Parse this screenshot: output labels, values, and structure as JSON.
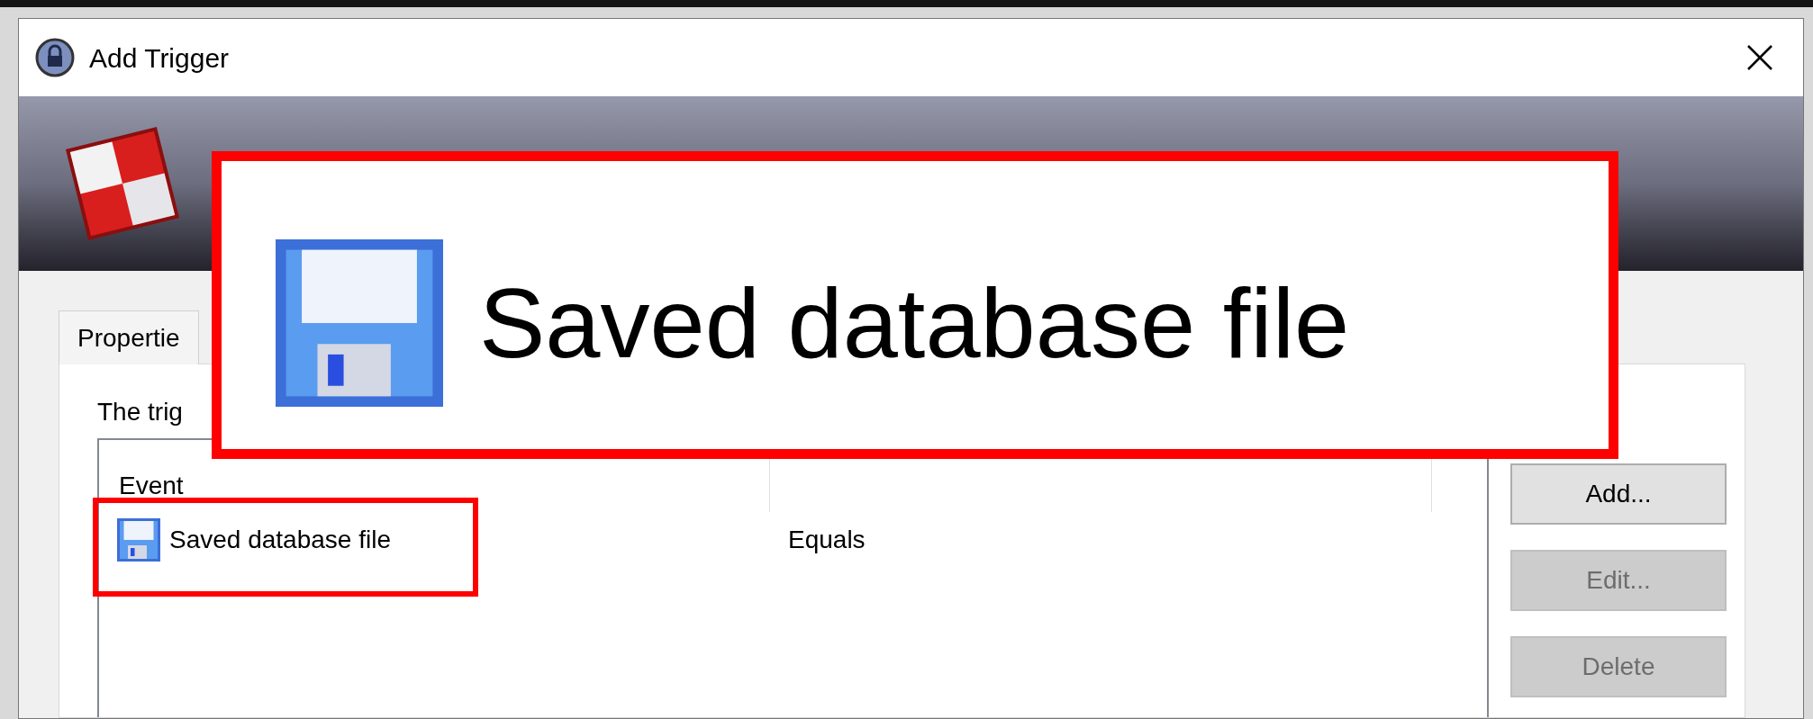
{
  "window": {
    "title": "Add Trigger"
  },
  "tabs": [
    {
      "label": "Propertie",
      "selected": true
    }
  ],
  "panel": {
    "intro": "The trig"
  },
  "list": {
    "columns": [
      "Event"
    ],
    "rows": [
      {
        "cells": [
          "Saved database file",
          "Equals"
        ]
      }
    ]
  },
  "buttons": [
    {
      "label": "Add...",
      "disabled": false
    },
    {
      "label": "Edit...",
      "disabled": true
    },
    {
      "label": "Delete",
      "disabled": true
    }
  ],
  "callout": {
    "text": "Saved database file"
  }
}
